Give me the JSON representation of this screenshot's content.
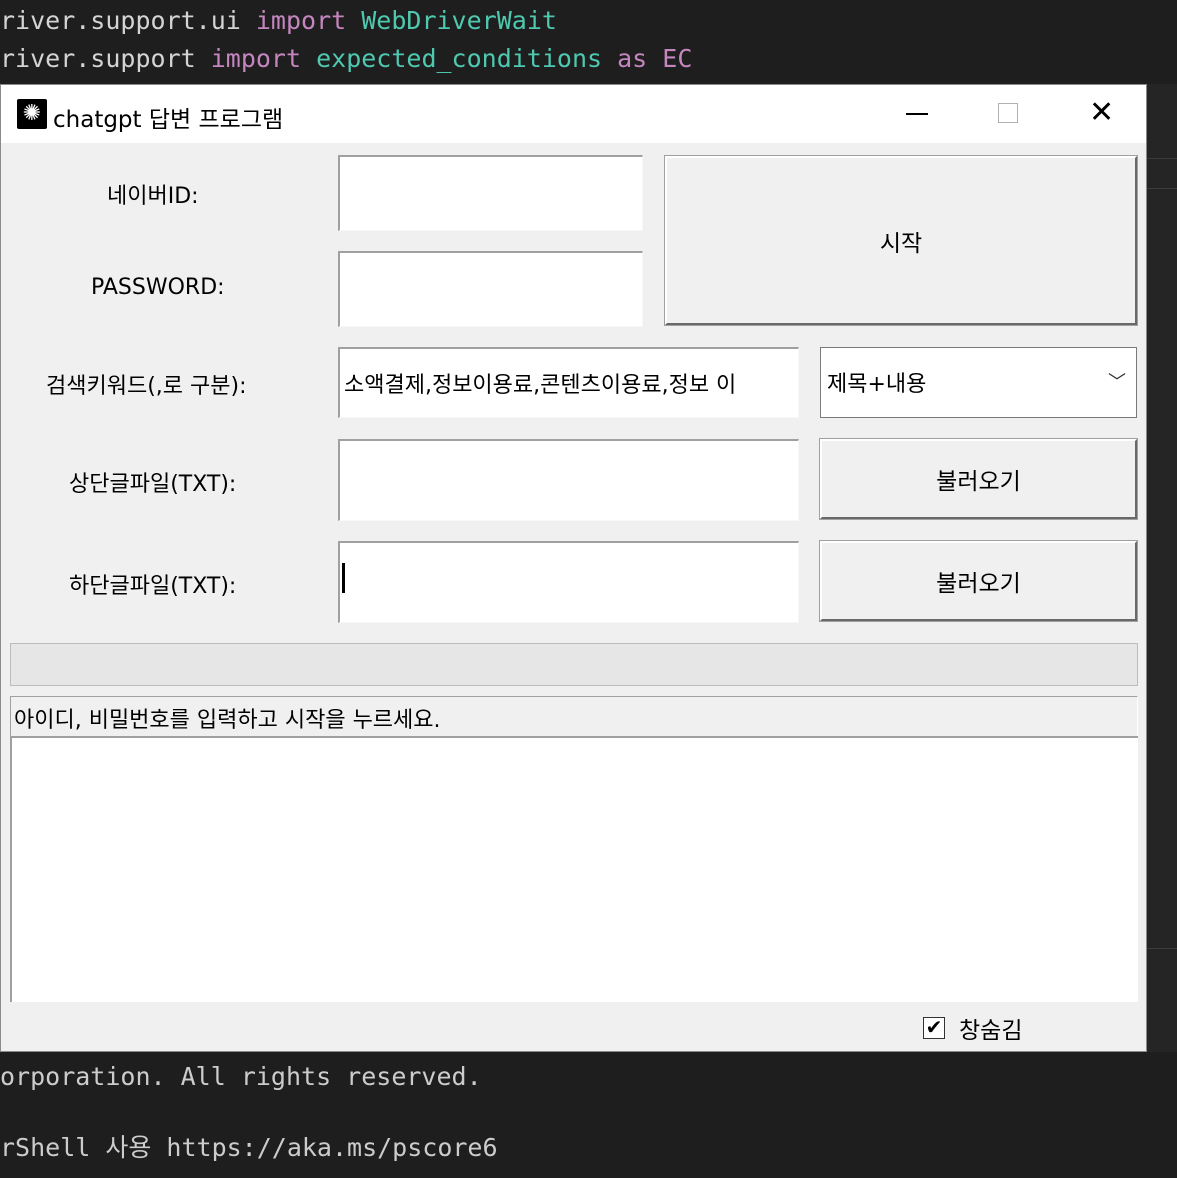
{
  "background": {
    "code_lines": [
      {
        "a": "river.support.ui ",
        "kw": "import",
        "b": " ",
        "cls": "WebDriverWait",
        "c": ""
      },
      {
        "a": "river.support ",
        "kw": "import",
        "b": " ",
        "cls": "expected_conditions",
        "c": " as EC"
      }
    ],
    "terminal_lines": [
      "orporation. All rights reserved.",
      "rShell 사용 https://aka.ms/pscore6"
    ]
  },
  "window": {
    "title": "chatgpt 답변 프로그램",
    "icon": "openai-logo-icon",
    "controls": {
      "minimize": "minimize",
      "maximize": "maximize",
      "close": "close"
    }
  },
  "form": {
    "naver_id_label": "네이버ID:",
    "naver_id_value": "",
    "password_label": "PASSWORD:",
    "password_value": "",
    "start_button": "시작",
    "keyword_label": "검색키워드(,로 구분):",
    "keyword_value": "소액결제,정보이용료,콘텐츠이용료,정보 이",
    "search_scope_selected": "제목+내용",
    "top_file_label": "상단글파일(TXT):",
    "top_file_value": "",
    "top_file_button": "불러오기",
    "bottom_file_label": "하단글파일(TXT):",
    "bottom_file_value": "",
    "bottom_file_button": "불러오기"
  },
  "progress": {
    "value": 0
  },
  "status_text": "아이디, 비밀번호를 입력하고 시작을 누르세요.",
  "log_text": "",
  "hide_window": {
    "label": "창숨김",
    "checked": true
  }
}
